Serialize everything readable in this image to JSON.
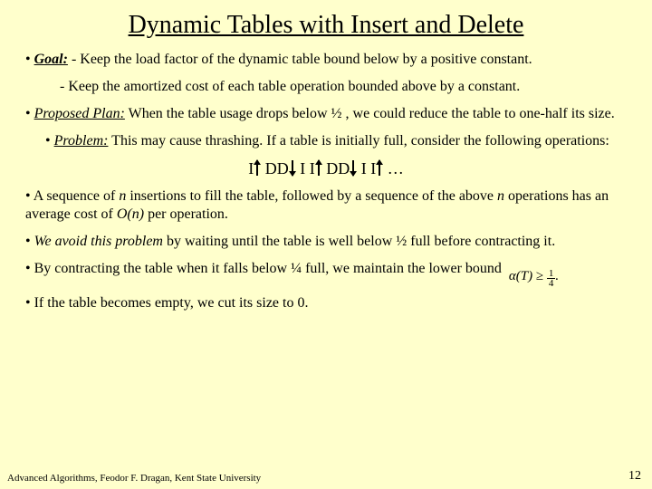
{
  "title": "Dynamic Tables with Insert and Delete",
  "goal_label": "Goal:",
  "goal_line1_prefix": " - ",
  "goal_line1": "Keep the load factor of the dynamic table bound below by a positive constant.",
  "goal_line2_prefix": "- ",
  "goal_line2": "Keep the amortized cost of each table operation bounded above by a constant.",
  "proposed_label": "Proposed Plan:",
  "proposed_text": " When the table usage drops below ½ , we could reduce the table to one-half its size.",
  "problem_label": "Problem:",
  "problem_text": " This may cause thrashing. If a table is initially full, consider the following operations:",
  "seq": {
    "p1": "I",
    "p2": "DD",
    "p3": "I I",
    "p4": "DD",
    "p5": "I I",
    "p6": "…"
  },
  "seq_note_a": "• A sequence of ",
  "seq_note_b": " insertions to fill the table, followed by a sequence of the above ",
  "seq_note_c": " operations has an average cost of ",
  "seq_note_d": " per operation.",
  "n": "n",
  "On": "O(n)",
  "avoid_label": "We avoid this problem",
  "avoid_text": " by waiting until the table is well below ½ full before contracting it.",
  "contract_text": "• By contracting the table when it falls below ¼ full, we maintain the lower bound",
  "formula_lhs": "α(T) ≥ ",
  "frac_num": "1",
  "frac_den": "4",
  "formula_period": ".",
  "empty_text": "• If the table becomes empty, we cut its size to 0.",
  "footer": "Advanced Algorithms, Feodor F. Dragan, Kent State University",
  "page": "12"
}
